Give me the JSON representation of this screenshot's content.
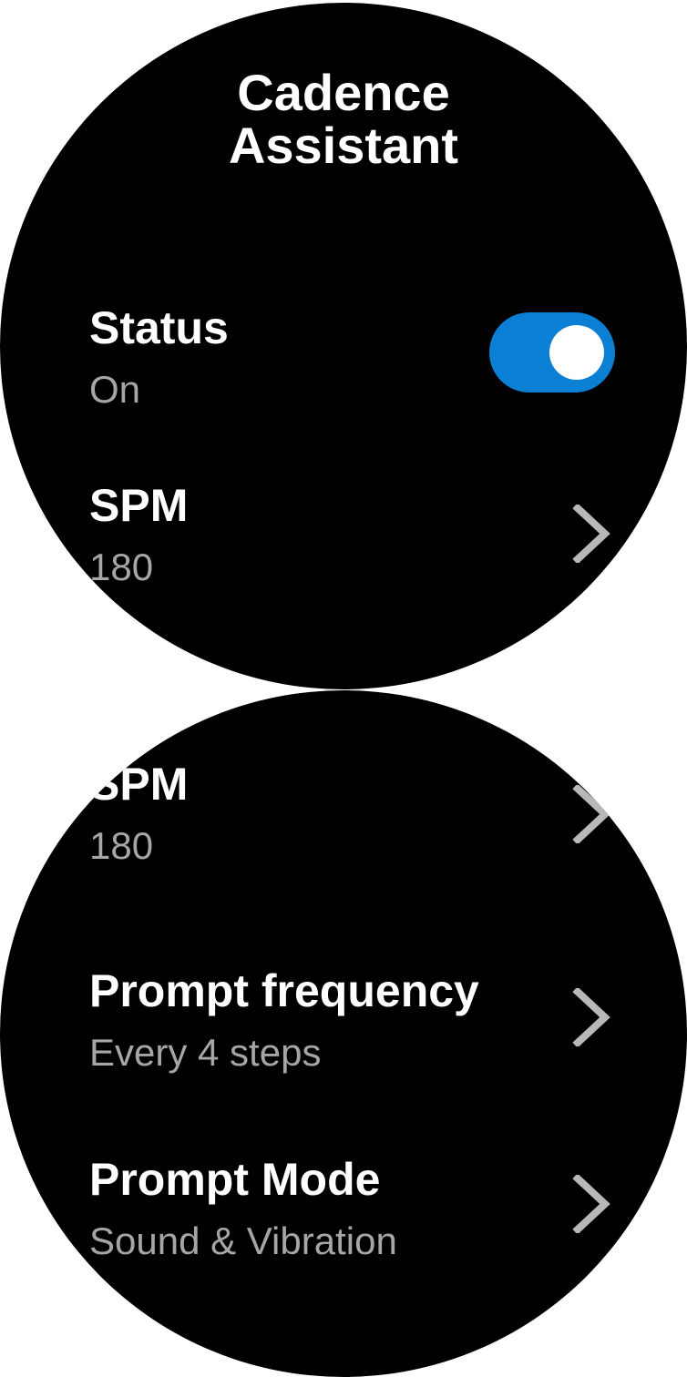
{
  "screen1": {
    "title_line1": "Cadence",
    "title_line2": "Assistant",
    "status": {
      "label": "Status",
      "value": "On",
      "toggle_on": true,
      "toggle_color": "#0b7fd3"
    },
    "spm": {
      "label": "SPM",
      "value": "180"
    }
  },
  "screen2": {
    "spm": {
      "label": "SPM",
      "value": "180"
    },
    "prompt_frequency": {
      "label": "Prompt frequency",
      "value": "Every  4 steps"
    },
    "prompt_mode": {
      "label": "Prompt Mode",
      "value": "Sound & Vibration"
    }
  },
  "icons": {
    "chevron": "chevron-right-icon"
  },
  "colors": {
    "background": "#000000",
    "primary_text": "#ffffff",
    "secondary_text": "#a6a6a6",
    "chevron": "#b8b8b8"
  }
}
